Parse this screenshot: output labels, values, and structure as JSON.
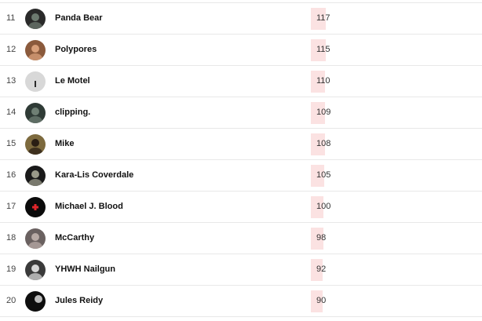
{
  "chart_list": {
    "max_count": 117,
    "rows": [
      {
        "rank": "11",
        "artist": "Panda Bear",
        "scrobbles": 117,
        "scrobbles_label": "117",
        "avatar_icon": "panda-bear-avatar-icon",
        "avatar_color": "#2a2a2a",
        "avatar_accent": "#6d7a70"
      },
      {
        "rank": "12",
        "artist": "Polypores",
        "scrobbles": 115,
        "scrobbles_label": "115",
        "avatar_icon": "polypores-avatar-icon",
        "avatar_color": "#8b5a3c",
        "avatar_accent": "#d9a07a"
      },
      {
        "rank": "13",
        "artist": "Le Motel",
        "scrobbles": 110,
        "scrobbles_label": "110",
        "avatar_icon": "le-motel-avatar-icon",
        "avatar_color": "#d8d8d8",
        "avatar_accent": "#2b2b2b"
      },
      {
        "rank": "14",
        "artist": "clipping.",
        "scrobbles": 109,
        "scrobbles_label": "109",
        "avatar_icon": "clipping-avatar-icon",
        "avatar_color": "#2f3b36",
        "avatar_accent": "#6f7f74"
      },
      {
        "rank": "15",
        "artist": "Mike",
        "scrobbles": 108,
        "scrobbles_label": "108",
        "avatar_icon": "mike-avatar-icon",
        "avatar_color": "#7d6a3e",
        "avatar_accent": "#2a1e14"
      },
      {
        "rank": "16",
        "artist": "Kara-Lis Coverdale",
        "scrobbles": 105,
        "scrobbles_label": "105",
        "avatar_icon": "kara-lis-coverdale-avatar-icon",
        "avatar_color": "#1a1a1a",
        "avatar_accent": "#9a9a8a"
      },
      {
        "rank": "17",
        "artist": "Michael J. Blood",
        "scrobbles": 100,
        "scrobbles_label": "100",
        "avatar_icon": "michael-j-blood-avatar-icon",
        "avatar_color": "#0b0b0b",
        "avatar_accent": "#e0262b"
      },
      {
        "rank": "18",
        "artist": "McCarthy",
        "scrobbles": 98,
        "scrobbles_label": "98",
        "avatar_icon": "mccarthy-avatar-icon",
        "avatar_color": "#6a6160",
        "avatar_accent": "#b8aaa5"
      },
      {
        "rank": "19",
        "artist": "YHWH Nailgun",
        "scrobbles": 92,
        "scrobbles_label": "92",
        "avatar_icon": "yhwh-nailgun-avatar-icon",
        "avatar_color": "#3a3a3a",
        "avatar_accent": "#d6d6d6"
      },
      {
        "rank": "20",
        "artist": "Jules Reidy",
        "scrobbles": 90,
        "scrobbles_label": "90",
        "avatar_icon": "jules-reidy-avatar-icon",
        "avatar_color": "#0e0e0e",
        "avatar_accent": "#e8e8e8"
      }
    ]
  },
  "colors": {
    "bar_fill": "#fbe2e2",
    "row_divider": "#e8e8e8"
  }
}
